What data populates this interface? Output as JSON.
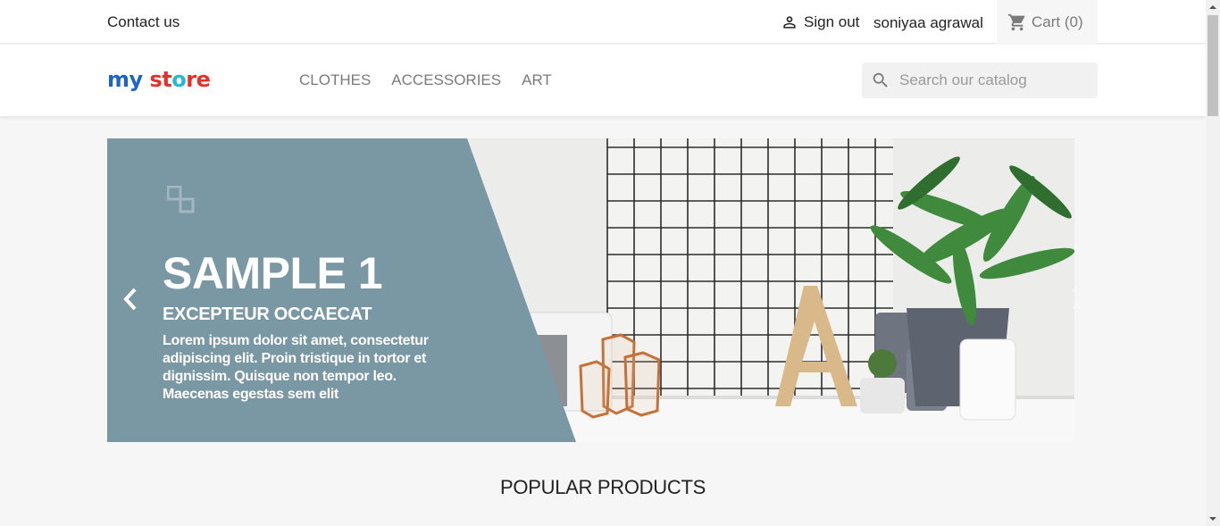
{
  "topbar": {
    "contact_label": "Contact us",
    "signout_label": "Sign out",
    "user_name": "soniyaa agrawal",
    "cart_label": "Cart",
    "cart_count": "(0)"
  },
  "header": {
    "logo_parts": [
      "my",
      " st",
      "o",
      "re"
    ],
    "nav": [
      "CLOTHES",
      "ACCESSORIES",
      "ART"
    ],
    "search_placeholder": "Search our catalog"
  },
  "slider": {
    "title": "SAMPLE 1",
    "subtitle": "EXCEPTEUR OCCAECAT",
    "text": "Lorem ipsum dolor sit amet, consectetur adipiscing elit. Proin tristique in tortor et dignissim. Quisque non tempor leo. Maecenas egestas sem elit",
    "panel_color": "#7a97a4"
  },
  "sections": {
    "popular_title": "POPULAR PRODUCTS"
  },
  "icons": {
    "signout": "person-icon",
    "cart": "shopping-cart-icon",
    "search": "search-icon",
    "slide": "squares-icon",
    "prev": "chevron-left-icon",
    "next": "chevron-right-icon"
  }
}
